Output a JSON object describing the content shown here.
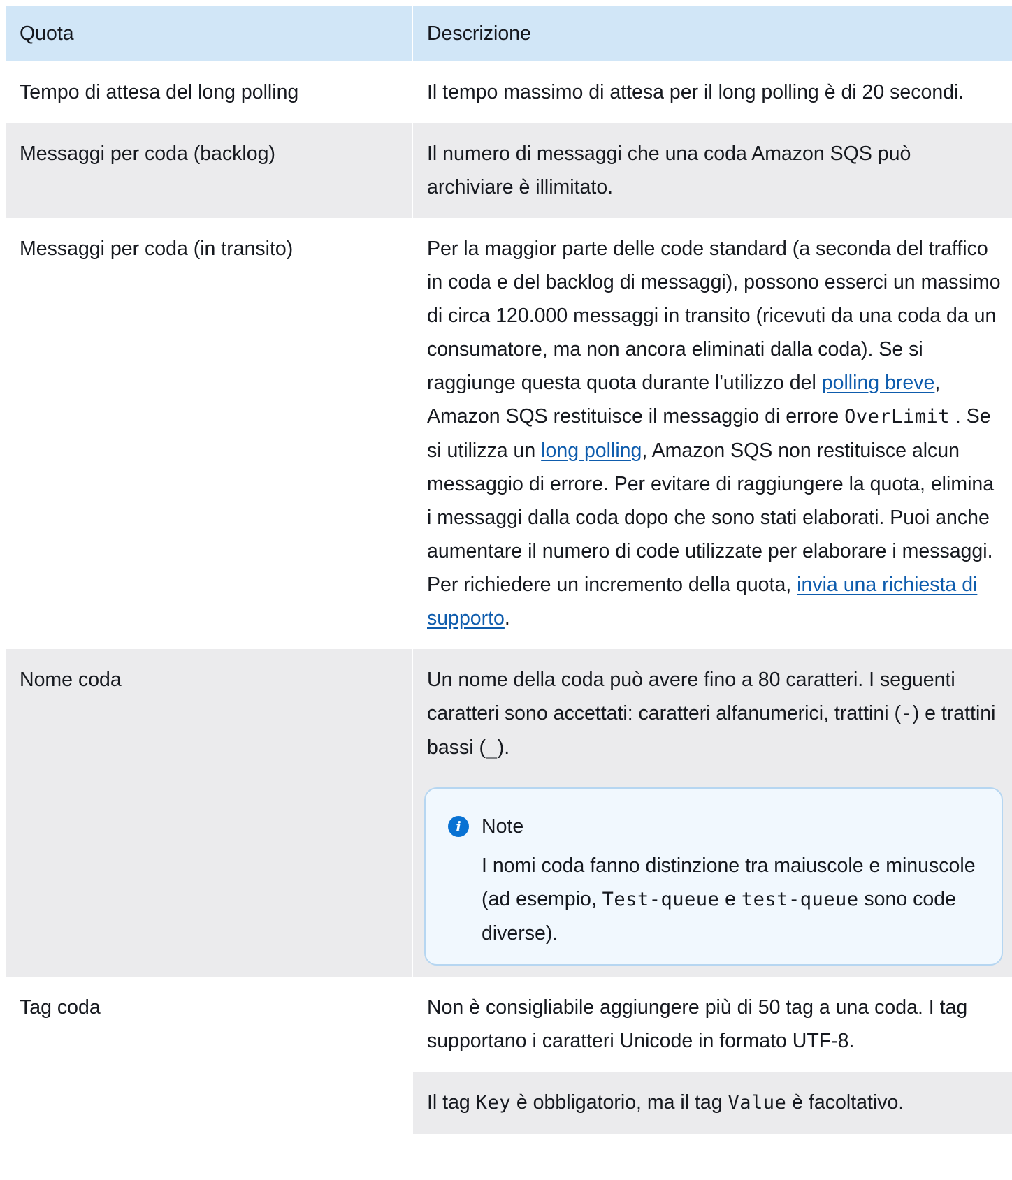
{
  "header": {
    "col1": "Quota",
    "col2": "Descrizione"
  },
  "rows": {
    "r1": {
      "name": "Tempo di attesa del long polling",
      "desc": "Il tempo massimo di attesa per il long polling è di 20 secondi."
    },
    "r2": {
      "name": "Messaggi per coda (backlog)",
      "desc": "Il numero di messaggi che una coda Amazon SQS può archiviare è illimitato."
    },
    "r3": {
      "name": "Messaggi per coda (in transito)",
      "desc_part1": "Per la maggior parte delle code standard (a seconda del traffico in coda e del backlog di messaggi), possono esserci un massimo di circa 120.000 messaggi in transito (ricevuti da una coda da un consumatore, ma non ancora eliminati dalla coda). Se si raggiunge questa quota durante l'utilizzo del ",
      "link1": "polling breve",
      "desc_part2": ", Amazon SQS restituisce il messaggio di errore ",
      "code1": "OverLimit",
      "desc_part3": " . Se si utilizza un ",
      "link2": "long polling",
      "desc_part4": ", Amazon SQS non restituisce alcun messaggio di errore. Per evitare di raggiungere la quota, elimina i messaggi dalla coda dopo che sono stati elaborati. Puoi anche aumentare il numero di code utilizzate per elaborare i messaggi. Per richiedere un incremento della quota, ",
      "link3": "invia una richiesta di supporto",
      "desc_part5": "."
    },
    "r4": {
      "name": "Nome coda",
      "desc_part1": "Un nome della coda può avere fino a 80 caratteri. I seguenti caratteri sono accettati: caratteri alfanumerici, trattini (",
      "code1": "-",
      "desc_part2": ") e trattini bassi (",
      "code2": "_",
      "desc_part3": ").",
      "note": {
        "icon": "info-icon",
        "title": "Note",
        "part1": "I nomi coda fanno distinzione tra maiuscole e minuscole (ad esempio, ",
        "code1": "Test-queue",
        "part2": " e ",
        "code2": "test-queue",
        "part3": " sono code diverse)."
      }
    },
    "r5": {
      "name": "Tag coda",
      "desc_a": "Non è consigliabile aggiungere più di 50 tag a una coda. I tag supportano i caratteri Unicode in formato UTF-8.",
      "desc_b_part1": "Il tag ",
      "code1": "Key",
      "desc_b_part2": " è obbligatorio, ma il tag ",
      "code2": "Value",
      "desc_b_part3": " è facoltativo."
    }
  },
  "colors": {
    "header_bg": "#d1e6f7",
    "row_alt_bg": "#ebebed",
    "link": "#0e5cad",
    "note_border": "#b6d6f1",
    "note_bg": "#f1f8fe",
    "info_icon": "#0972d3"
  }
}
